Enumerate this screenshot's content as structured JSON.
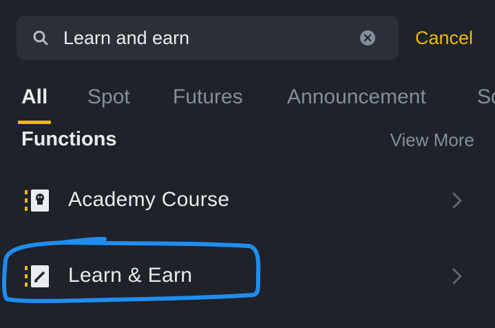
{
  "search": {
    "value": "Learn and earn",
    "cancel_label": "Cancel",
    "icon": "search-icon",
    "clear_icon": "clear-icon"
  },
  "tabs": [
    {
      "label": "All",
      "active": true
    },
    {
      "label": "Spot",
      "active": false
    },
    {
      "label": "Futures",
      "active": false
    },
    {
      "label": "Announcement",
      "active": false
    },
    {
      "label": "Sq",
      "active": false
    }
  ],
  "functions": {
    "title": "Functions",
    "view_more": "View More",
    "items": [
      {
        "label": "Academy Course",
        "icon": "academy-icon"
      },
      {
        "label": "Learn & Earn",
        "icon": "learn-earn-icon"
      }
    ]
  },
  "colors": {
    "background": "#1f2229",
    "search_bg": "#2b2f36",
    "accent": "#f0b90b",
    "primary_text": "#eaecef",
    "secondary_text": "#848e9c",
    "highlight_stroke": "#1e8ef0"
  }
}
